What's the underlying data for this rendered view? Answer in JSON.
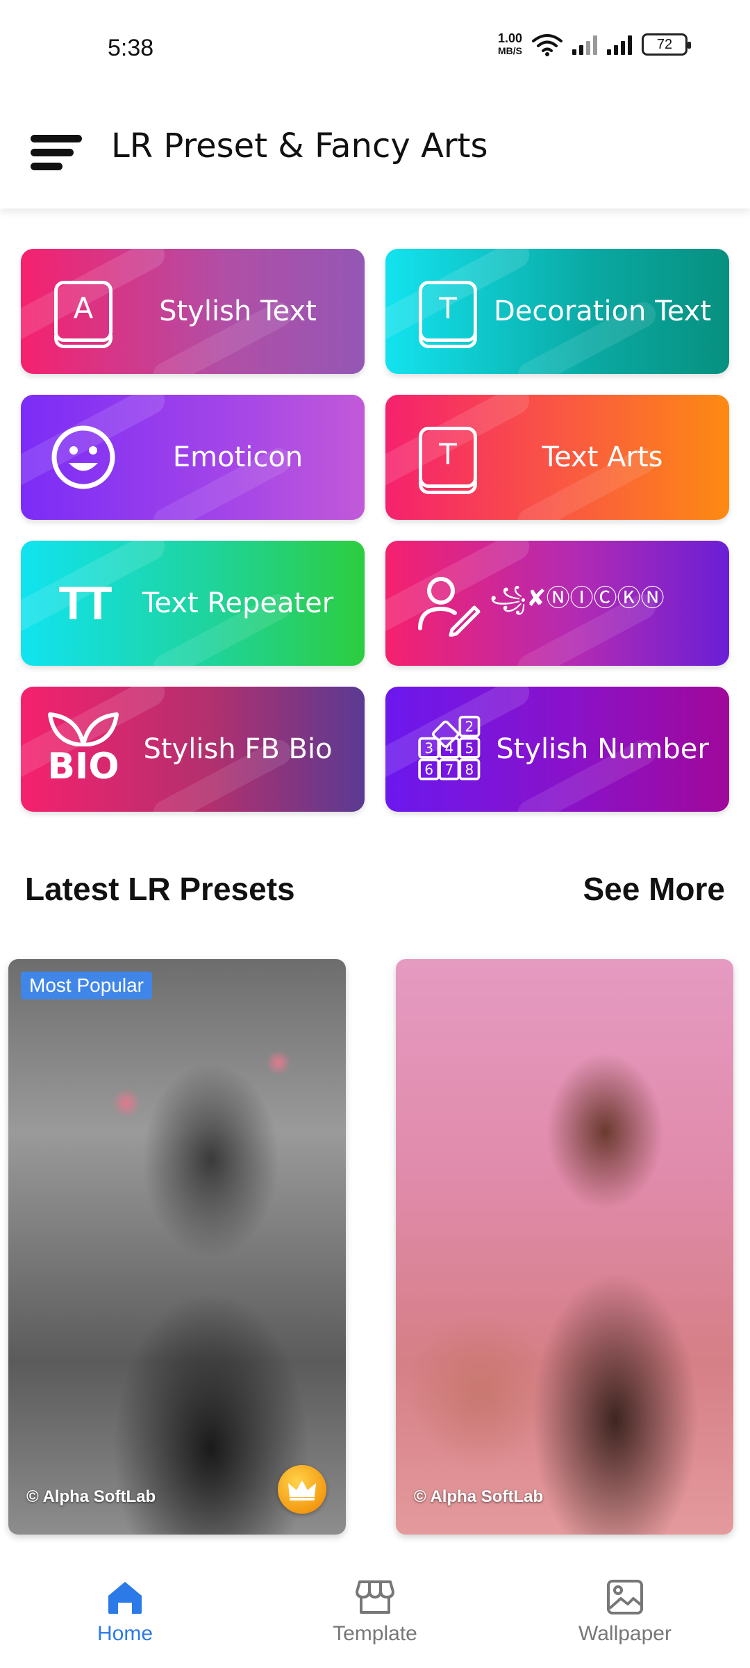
{
  "status_bar": {
    "time": "5:38",
    "net_speed_value": "1.00",
    "net_speed_unit": "MB/S",
    "battery": "72"
  },
  "app_bar": {
    "title": "LR Preset & Fancy Arts",
    "menu_icon": "hamburger-menu-icon"
  },
  "features": [
    {
      "label": "Stylish Text",
      "icon": "keycap-a-icon",
      "glyph": "A"
    },
    {
      "label": "Decoration Text",
      "icon": "keycap-t-icon",
      "glyph": "T"
    },
    {
      "label": "Emoticon",
      "icon": "smiley-icon"
    },
    {
      "label": "Text Arts",
      "icon": "keycap-t-icon",
      "glyph": "T"
    },
    {
      "label": "Text Repeater",
      "icon": "text-size-icon",
      "glyph": "TT"
    },
    {
      "label": "꧁✘ⓃⒾⒸⓀⓃ",
      "icon": "user-edit-icon"
    },
    {
      "label": "Stylish FB Bio",
      "icon": "bio-leaf-icon",
      "glyph": "BIO"
    },
    {
      "label": "Stylish Number",
      "icon": "number-grid-icon"
    }
  ],
  "presets_section": {
    "title": "Latest LR Presets",
    "see_more": "See More"
  },
  "presets": [
    {
      "badge": "Most Popular",
      "watermark": "© Alpha SoftLab",
      "premium_icon": "crown-icon"
    },
    {
      "watermark": "© Alpha SoftLab"
    }
  ],
  "bottom_nav": [
    {
      "label": "Home",
      "icon": "home-icon",
      "active": true
    },
    {
      "label": "Template",
      "icon": "store-icon",
      "active": false
    },
    {
      "label": "Wallpaper",
      "icon": "image-icon",
      "active": false
    }
  ],
  "colors": {
    "accent": "#2b7ae8",
    "badge": "#3f86e8",
    "nav_inactive": "#777777"
  }
}
